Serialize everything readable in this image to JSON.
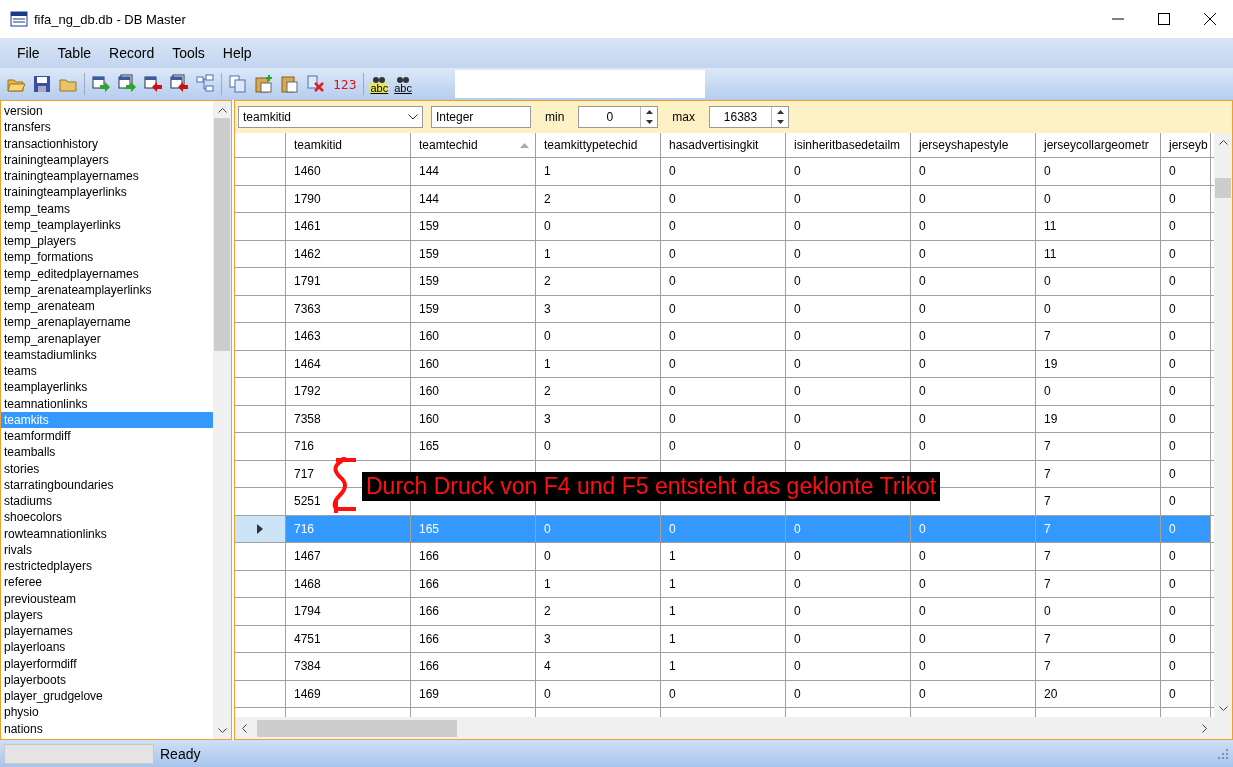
{
  "window": {
    "title": "fifa_ng_db.db - DB Master"
  },
  "menu": [
    "File",
    "Table",
    "Record",
    "Tools",
    "Help"
  ],
  "toolbar": [
    {
      "kind": "open"
    },
    {
      "kind": "save"
    },
    {
      "kind": "folder"
    },
    {
      "kind": "sep"
    },
    {
      "kind": "import"
    },
    {
      "kind": "import-all"
    },
    {
      "kind": "export"
    },
    {
      "kind": "export-all"
    },
    {
      "kind": "tree"
    },
    {
      "kind": "sep"
    },
    {
      "kind": "copy"
    },
    {
      "kind": "paste-add"
    },
    {
      "kind": "paste"
    },
    {
      "kind": "delete"
    },
    {
      "kind": "number",
      "label": "123"
    },
    {
      "kind": "sep"
    },
    {
      "kind": "find",
      "label": "abc"
    },
    {
      "kind": "find-next",
      "label": "abc"
    }
  ],
  "tables": [
    {
      "name": "version",
      "selected": false
    },
    {
      "name": "transfers",
      "selected": false
    },
    {
      "name": "transactionhistory",
      "selected": false
    },
    {
      "name": "trainingteamplayers",
      "selected": false
    },
    {
      "name": "trainingteamplayernames",
      "selected": false
    },
    {
      "name": "trainingteamplayerlinks",
      "selected": false
    },
    {
      "name": "temp_teams",
      "selected": false
    },
    {
      "name": "temp_teamplayerlinks",
      "selected": false
    },
    {
      "name": "temp_players",
      "selected": false
    },
    {
      "name": "temp_formations",
      "selected": false
    },
    {
      "name": "temp_editedplayernames",
      "selected": false
    },
    {
      "name": "temp_arenateamplayerlinks",
      "selected": false
    },
    {
      "name": "temp_arenateam",
      "selected": false
    },
    {
      "name": "temp_arenaplayername",
      "selected": false
    },
    {
      "name": "temp_arenaplayer",
      "selected": false
    },
    {
      "name": "teamstadiumlinks",
      "selected": false
    },
    {
      "name": "teams",
      "selected": false
    },
    {
      "name": "teamplayerlinks",
      "selected": false
    },
    {
      "name": "teamnationlinks",
      "selected": false
    },
    {
      "name": "teamkits",
      "selected": true
    },
    {
      "name": "teamformdiff",
      "selected": false
    },
    {
      "name": "teamballs",
      "selected": false
    },
    {
      "name": "stories",
      "selected": false
    },
    {
      "name": "starratingboundaries",
      "selected": false
    },
    {
      "name": "stadiums",
      "selected": false
    },
    {
      "name": "shoecolors",
      "selected": false
    },
    {
      "name": "rowteamnationlinks",
      "selected": false
    },
    {
      "name": "rivals",
      "selected": false
    },
    {
      "name": "restrictedplayers",
      "selected": false
    },
    {
      "name": "referee",
      "selected": false
    },
    {
      "name": "previousteam",
      "selected": false
    },
    {
      "name": "players",
      "selected": false
    },
    {
      "name": "playernames",
      "selected": false
    },
    {
      "name": "playerloans",
      "selected": false
    },
    {
      "name": "playerformdiff",
      "selected": false
    },
    {
      "name": "playerboots",
      "selected": false
    },
    {
      "name": "player_grudgelove",
      "selected": false
    },
    {
      "name": "physio",
      "selected": false
    },
    {
      "name": "nations",
      "selected": false
    }
  ],
  "field_filter": {
    "field": "teamkitid",
    "type": "Integer",
    "min_label": "min",
    "min": "0",
    "max_label": "max",
    "max": "16383"
  },
  "table": {
    "columns": [
      {
        "label": "teamkitid",
        "sorted": false
      },
      {
        "label": "teamtechid",
        "sorted": true
      },
      {
        "label": "teamkittypetechid",
        "sorted": false
      },
      {
        "label": "hasadvertisingkit",
        "sorted": false
      },
      {
        "label": "isinheritbasedetailm",
        "sorted": false
      },
      {
        "label": "jerseyshapestyle",
        "sorted": false
      },
      {
        "label": "jerseycollargeometr",
        "sorted": false
      },
      {
        "label": "jerseyb",
        "sorted": false
      }
    ],
    "rows": [
      {
        "selected": false,
        "cells": [
          "1460",
          "144",
          "1",
          "0",
          "0",
          "0",
          "0",
          "0"
        ]
      },
      {
        "selected": false,
        "cells": [
          "1790",
          "144",
          "2",
          "0",
          "0",
          "0",
          "0",
          "0"
        ]
      },
      {
        "selected": false,
        "cells": [
          "1461",
          "159",
          "0",
          "0",
          "0",
          "0",
          "11",
          "0"
        ]
      },
      {
        "selected": false,
        "cells": [
          "1462",
          "159",
          "1",
          "0",
          "0",
          "0",
          "11",
          "0"
        ]
      },
      {
        "selected": false,
        "cells": [
          "1791",
          "159",
          "2",
          "0",
          "0",
          "0",
          "0",
          "0"
        ]
      },
      {
        "selected": false,
        "cells": [
          "7363",
          "159",
          "3",
          "0",
          "0",
          "0",
          "0",
          "0"
        ]
      },
      {
        "selected": false,
        "cells": [
          "1463",
          "160",
          "0",
          "0",
          "0",
          "0",
          "7",
          "0"
        ]
      },
      {
        "selected": false,
        "cells": [
          "1464",
          "160",
          "1",
          "0",
          "0",
          "0",
          "19",
          "0"
        ]
      },
      {
        "selected": false,
        "cells": [
          "1792",
          "160",
          "2",
          "0",
          "0",
          "0",
          "0",
          "0"
        ]
      },
      {
        "selected": false,
        "cells": [
          "7358",
          "160",
          "3",
          "0",
          "0",
          "0",
          "19",
          "0"
        ]
      },
      {
        "selected": false,
        "cells": [
          "716",
          "165",
          "0",
          "0",
          "0",
          "0",
          "7",
          "0"
        ]
      },
      {
        "selected": false,
        "cells": [
          "717",
          null,
          null,
          null,
          null,
          null,
          "7",
          "0"
        ]
      },
      {
        "selected": false,
        "cells": [
          "5251",
          null,
          null,
          null,
          null,
          null,
          "7",
          "0"
        ]
      },
      {
        "selected": true,
        "cells": [
          "716",
          "165",
          "0",
          "0",
          "0",
          "0",
          "7",
          "0"
        ]
      },
      {
        "selected": false,
        "cells": [
          "1467",
          "166",
          "0",
          "1",
          "0",
          "0",
          "7",
          "0"
        ]
      },
      {
        "selected": false,
        "cells": [
          "1468",
          "166",
          "1",
          "1",
          "0",
          "0",
          "7",
          "0"
        ]
      },
      {
        "selected": false,
        "cells": [
          "1794",
          "166",
          "2",
          "1",
          "0",
          "0",
          "0",
          "0"
        ]
      },
      {
        "selected": false,
        "cells": [
          "4751",
          "166",
          "3",
          "1",
          "0",
          "0",
          "7",
          "0"
        ]
      },
      {
        "selected": false,
        "cells": [
          "7384",
          "166",
          "4",
          "1",
          "0",
          "0",
          "7",
          "0"
        ]
      },
      {
        "selected": false,
        "cells": [
          "1469",
          "169",
          "0",
          "0",
          "0",
          "0",
          "20",
          "0"
        ]
      }
    ]
  },
  "annotation": {
    "text": "Durch Druck von F4 und F5 entsteht das geklonte Trikot"
  },
  "status_bar": {
    "text": "Ready"
  }
}
